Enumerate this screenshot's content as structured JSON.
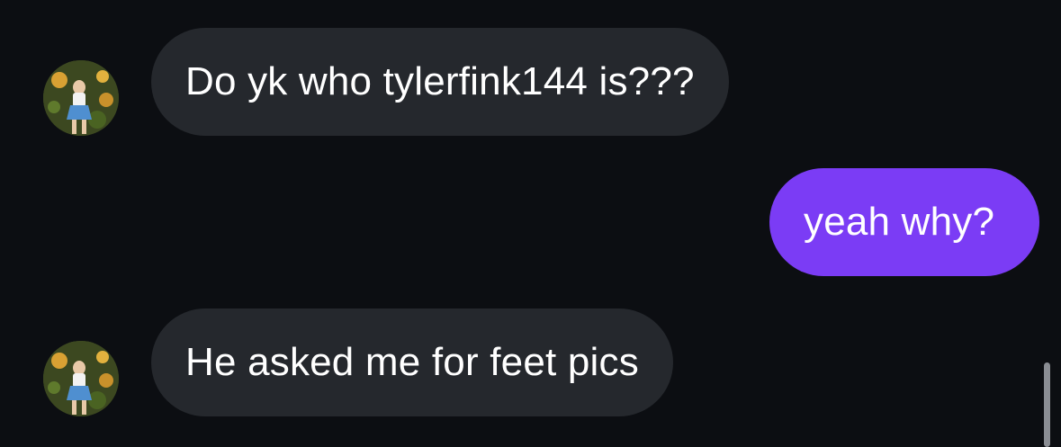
{
  "messages": [
    {
      "direction": "incoming",
      "text": "Do yk who tylerfink144 is???",
      "avatar": "sender-avatar-photo"
    },
    {
      "direction": "outgoing",
      "text": "yeah why?"
    },
    {
      "direction": "incoming",
      "text": "He asked me for feet pics",
      "avatar": "sender-avatar-photo"
    }
  ],
  "colors": {
    "background": "#0c0e12",
    "incoming_bubble": "#25282d",
    "outgoing_bubble": "#7b3cf5",
    "text": "#ffffff"
  }
}
